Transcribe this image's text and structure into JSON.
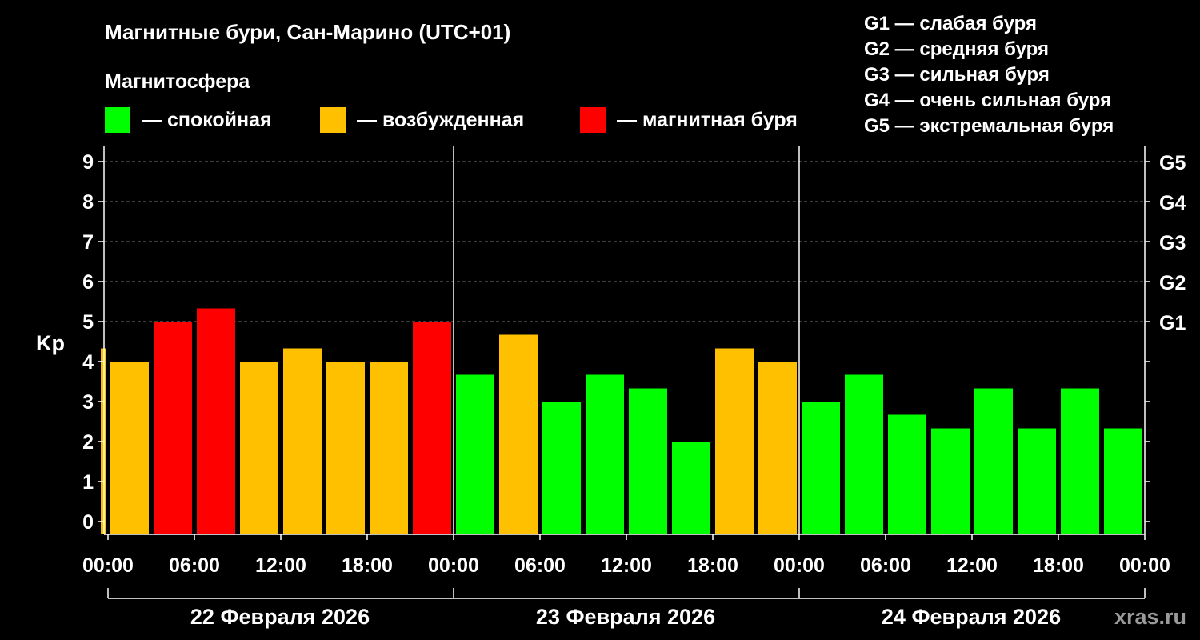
{
  "title": "Магнитные бури, Сан-Марино (UTC+01)",
  "subtitle": "Магнитосфера",
  "legend": [
    {
      "label": "— спокойная",
      "color": "#00ff00"
    },
    {
      "label": "— возбужденная",
      "color": "#ffc000"
    },
    {
      "label": "— магнитная буря",
      "color": "#ff0000"
    }
  ],
  "g_scale_legend": [
    "G1 — слабая буря",
    "G2 — средняя буря",
    "G3 — сильная буря",
    "G4 — очень сильная буря",
    "G5 — экстремальная буря"
  ],
  "watermark": "xras.ru",
  "colors": {
    "background": "#000000",
    "quiet": "#00ff00",
    "active": "#ffc000",
    "storm": "#ff0000",
    "axis": "#ffffff",
    "grid": "#7a7a7a"
  },
  "chart_data": {
    "type": "bar",
    "ylabel": "Kp",
    "ylim": [
      0,
      9
    ],
    "yticks": [
      "0",
      "1",
      "2",
      "3",
      "4",
      "5",
      "6",
      "7",
      "8",
      "9"
    ],
    "right_ticks": [
      {
        "kp": 5,
        "label": "G1"
      },
      {
        "kp": 6,
        "label": "G2"
      },
      {
        "kp": 7,
        "label": "G3"
      },
      {
        "kp": 8,
        "label": "G4"
      },
      {
        "kp": 9,
        "label": "G5"
      }
    ],
    "grid": true,
    "x_tick_labels": [
      "00:00",
      "06:00",
      "12:00",
      "18:00",
      "00:00",
      "06:00",
      "12:00",
      "18:00",
      "00:00",
      "06:00",
      "12:00",
      "18:00",
      "00:00"
    ],
    "days": [
      "22 Февраля 2026",
      "23 Февраля 2026",
      "24 Февраля 2026"
    ],
    "bar_interval_hours": 3,
    "x_start_hour": -0.5,
    "x_end_hour": 72,
    "series": [
      {
        "values": [
          {
            "start_hour": -0.5,
            "end_hour": 0,
            "kp": 4.33,
            "level": "active"
          },
          {
            "start_hour": 0,
            "end_hour": 3,
            "kp": 4.0,
            "level": "active"
          },
          {
            "start_hour": 3,
            "end_hour": 6,
            "kp": 5.0,
            "level": "storm"
          },
          {
            "start_hour": 6,
            "end_hour": 9,
            "kp": 5.33,
            "level": "storm"
          },
          {
            "start_hour": 9,
            "end_hour": 12,
            "kp": 4.0,
            "level": "active"
          },
          {
            "start_hour": 12,
            "end_hour": 15,
            "kp": 4.33,
            "level": "active"
          },
          {
            "start_hour": 15,
            "end_hour": 18,
            "kp": 4.0,
            "level": "active"
          },
          {
            "start_hour": 18,
            "end_hour": 21,
            "kp": 4.0,
            "level": "active"
          },
          {
            "start_hour": 21,
            "end_hour": 24,
            "kp": 5.0,
            "level": "storm"
          },
          {
            "start_hour": 24,
            "end_hour": 27,
            "kp": 3.67,
            "level": "quiet"
          },
          {
            "start_hour": 27,
            "end_hour": 30,
            "kp": 4.67,
            "level": "active"
          },
          {
            "start_hour": 30,
            "end_hour": 33,
            "kp": 3.0,
            "level": "quiet"
          },
          {
            "start_hour": 33,
            "end_hour": 36,
            "kp": 3.67,
            "level": "quiet"
          },
          {
            "start_hour": 36,
            "end_hour": 39,
            "kp": 3.33,
            "level": "quiet"
          },
          {
            "start_hour": 39,
            "end_hour": 42,
            "kp": 2.0,
            "level": "quiet"
          },
          {
            "start_hour": 42,
            "end_hour": 45,
            "kp": 4.33,
            "level": "active"
          },
          {
            "start_hour": 45,
            "end_hour": 48,
            "kp": 4.0,
            "level": "active"
          },
          {
            "start_hour": 48,
            "end_hour": 51,
            "kp": 3.0,
            "level": "quiet"
          },
          {
            "start_hour": 51,
            "end_hour": 54,
            "kp": 3.67,
            "level": "quiet"
          },
          {
            "start_hour": 54,
            "end_hour": 57,
            "kp": 2.67,
            "level": "quiet"
          },
          {
            "start_hour": 57,
            "end_hour": 60,
            "kp": 2.33,
            "level": "quiet"
          },
          {
            "start_hour": 60,
            "end_hour": 63,
            "kp": 3.33,
            "level": "quiet"
          },
          {
            "start_hour": 63,
            "end_hour": 66,
            "kp": 2.33,
            "level": "quiet"
          },
          {
            "start_hour": 66,
            "end_hour": 69,
            "kp": 3.33,
            "level": "quiet"
          },
          {
            "start_hour": 69,
            "end_hour": 72,
            "kp": 2.33,
            "level": "quiet"
          }
        ]
      }
    ]
  }
}
